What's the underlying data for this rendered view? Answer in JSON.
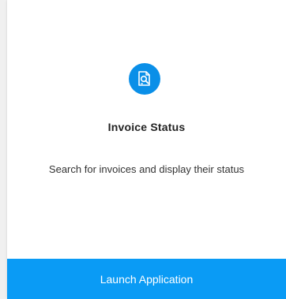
{
  "card": {
    "icon": "document-search-icon",
    "title": "Invoice Status",
    "description": "Search for invoices and display their status",
    "button_label": "Launch Application"
  },
  "colors": {
    "accent": "#0a9bf5",
    "icon_background": "#0a8fe8",
    "card_background": "#ffffff",
    "text": "#333333"
  }
}
